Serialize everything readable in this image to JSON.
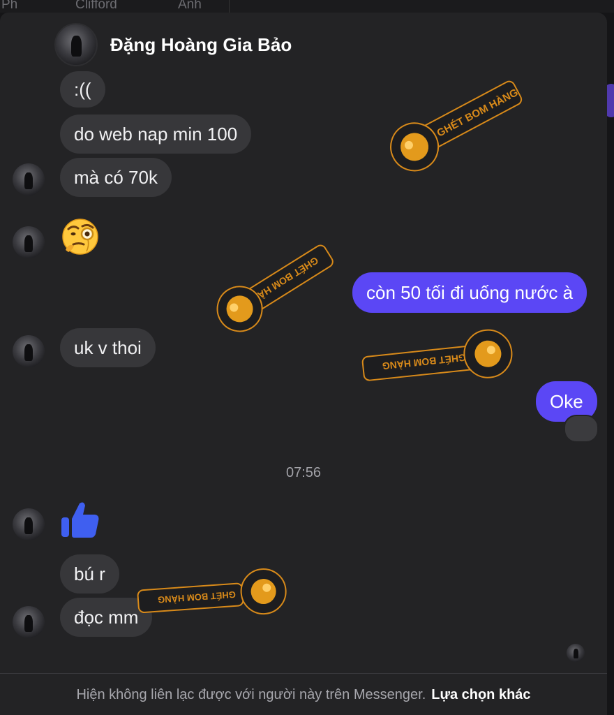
{
  "top_tabs": [
    "Ph",
    "Clifford",
    "Anh"
  ],
  "header": {
    "name": "Đặng Hoàng Gia Bảo"
  },
  "messages": [
    {
      "text": ":(("
    },
    {
      "text": "do web nap min 100"
    },
    {
      "text": "mà có 70k"
    },
    {
      "emoji": "monocle-face"
    },
    {
      "text": "còn 50 tối đi uống nước à"
    },
    {
      "text": "uk v thoi"
    },
    {
      "text": "Oke"
    },
    {
      "emoji": "thumbs-up"
    },
    {
      "text": "bú r"
    },
    {
      "text": "đọc mm"
    }
  ],
  "timestamp": "07:56",
  "watermark": {
    "text": "GHÉT BOM HÀNG",
    "color": "#d88a1a"
  },
  "footer": {
    "note": "Hiện không liên lạc được với người này trên Messenger.",
    "action": "Lựa chọn khác"
  },
  "colors": {
    "outgoing_bubble": "#5b47f5",
    "incoming_bubble": "#37373a",
    "background": "#232325",
    "like_icon": "#3f5ff0"
  }
}
